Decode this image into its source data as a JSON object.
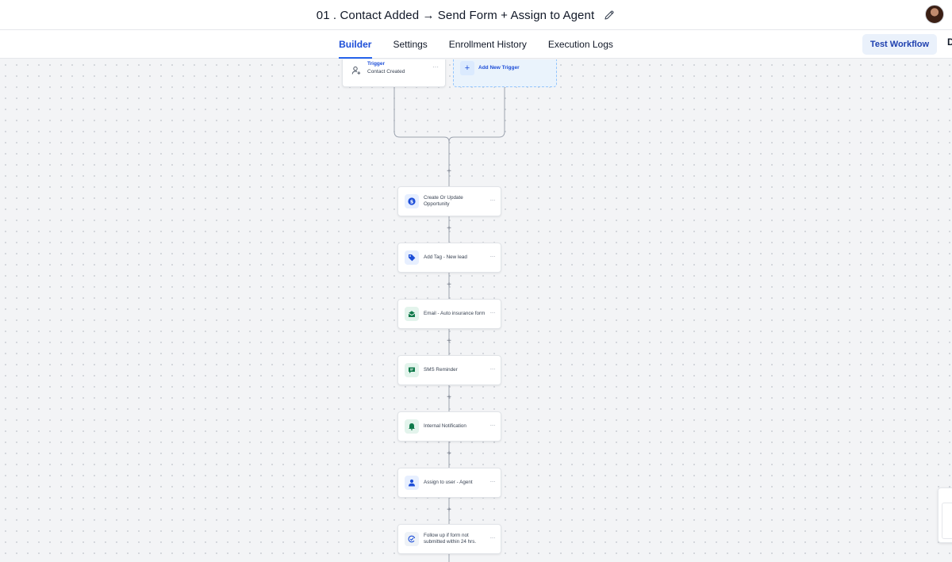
{
  "header": {
    "title": "01 . Contact Added → Send Form + Assign to Agent",
    "edit_icon": "pencil-icon",
    "avatar": "user-avatar"
  },
  "tabs": [
    {
      "label": "Builder",
      "active": true
    },
    {
      "label": "Settings",
      "active": false
    },
    {
      "label": "Enrollment History",
      "active": false
    },
    {
      "label": "Execution Logs",
      "active": false
    }
  ],
  "actions": {
    "test_workflow": "Test Workflow",
    "truncated_button": "D"
  },
  "colors": {
    "accent": "#2563eb",
    "action_blue": "#1d4ed8",
    "action_green": "#0f7a4a"
  },
  "trigger": {
    "title": "Trigger",
    "subtitle": "Contact Created",
    "more": "···",
    "icon": "user-plus-icon"
  },
  "add_trigger": {
    "label": "Add New Trigger",
    "plus": "+"
  },
  "steps": [
    {
      "label": "Create Or Update Opportunity",
      "icon": "dollar-icon",
      "more": "···"
    },
    {
      "label": "Add Tag - New lead",
      "icon": "tag-icon",
      "more": "···"
    },
    {
      "label": "Email - Auto insurance form",
      "icon": "email-icon",
      "more": "···"
    },
    {
      "label": "SMS Reminder",
      "icon": "sms-icon",
      "more": "···"
    },
    {
      "label": "Internal Notification",
      "icon": "bell-icon",
      "more": "···"
    },
    {
      "label": "Assign to user - Agent",
      "icon": "user-icon",
      "more": "···"
    },
    {
      "label": "Follow up if form not submitted within 24 hrs.",
      "icon": "followup-icon",
      "more": "···"
    }
  ],
  "add_step": "+"
}
